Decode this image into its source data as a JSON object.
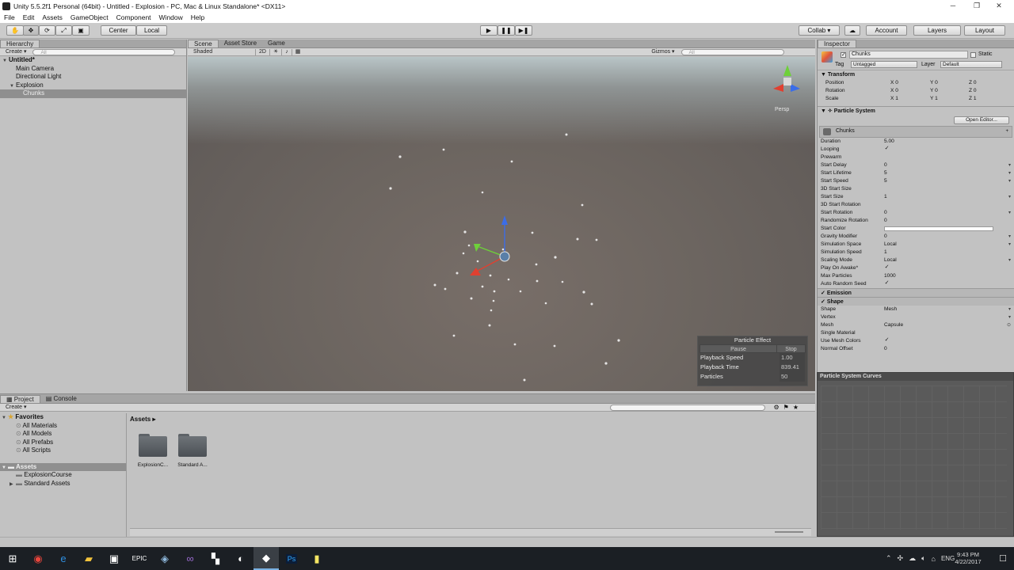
{
  "window": {
    "title": "Unity 5.5.2f1 Personal (64bit) - Untitled - Explosion - PC, Mac & Linux Standalone* <DX11>",
    "minimize": "─",
    "restore": "❐",
    "close": "✕"
  },
  "menu": [
    "File",
    "Edit",
    "Assets",
    "GameObject",
    "Component",
    "Window",
    "Help"
  ],
  "toolbar": {
    "pivot": "Center",
    "space": "Local",
    "collab": "Collab ▾",
    "account": "Account",
    "layers": "Layers",
    "layout": "Layout"
  },
  "hierarchy": {
    "tab": "Hierarchy",
    "create": "Create ▾",
    "search_placeholder": "All",
    "scene": "Untitled*",
    "items": [
      "Main Camera",
      "Directional Light",
      "Explosion",
      "Chunks"
    ]
  },
  "scene_view": {
    "tabs": [
      "Scene",
      "Asset Store",
      "Game"
    ],
    "shading": "Shaded",
    "mode_2d": "2D",
    "gizmos": "Gizmos ▾",
    "search_placeholder": "All",
    "persp": "Persp"
  },
  "particle_effect": {
    "title": "Particle Effect",
    "pause": "Pause",
    "stop": "Stop",
    "rows": [
      {
        "label": "Playback Speed",
        "value": "1.00"
      },
      {
        "label": "Playback Time",
        "value": "839.41"
      },
      {
        "label": "Particles",
        "value": "50"
      }
    ]
  },
  "inspector": {
    "tab": "Inspector",
    "object_name": "Chunks",
    "static": "Static",
    "tag_label": "Tag",
    "tag": "Untagged",
    "layer_label": "Layer",
    "layer": "Default",
    "transform": {
      "title": "Transform",
      "rows": [
        {
          "label": "Position",
          "x": "0",
          "y": "0",
          "z": "0"
        },
        {
          "label": "Rotation",
          "x": "0",
          "y": "0",
          "z": "0"
        },
        {
          "label": "Scale",
          "x": "1",
          "y": "1",
          "z": "1"
        }
      ]
    },
    "particle_system": {
      "title": "Particle System",
      "open_editor": "Open Editor...",
      "module_name": "Chunks",
      "props": [
        {
          "label": "Duration",
          "value": "5.00",
          "type": "text"
        },
        {
          "label": "Looping",
          "value": "✓",
          "type": "check"
        },
        {
          "label": "Prewarm",
          "value": "",
          "type": "check"
        },
        {
          "label": "Start Delay",
          "value": "0",
          "type": "drop"
        },
        {
          "label": "Start Lifetime",
          "value": "5",
          "type": "drop"
        },
        {
          "label": "Start Speed",
          "value": "5",
          "type": "drop"
        },
        {
          "label": "3D Start Size",
          "value": "",
          "type": "check"
        },
        {
          "label": "Start Size",
          "value": "1",
          "type": "drop"
        },
        {
          "label": "3D Start Rotation",
          "value": "",
          "type": "check"
        },
        {
          "label": "Start Rotation",
          "value": "0",
          "type": "drop"
        },
        {
          "label": "Randomize Rotation",
          "value": "0",
          "type": "text"
        },
        {
          "label": "Start Color",
          "value": "",
          "type": "color"
        },
        {
          "label": "Gravity Modifier",
          "value": "0",
          "type": "drop"
        },
        {
          "label": "Simulation Space",
          "value": "Local",
          "type": "drop"
        },
        {
          "label": "Simulation Speed",
          "value": "1",
          "type": "text"
        },
        {
          "label": "Scaling Mode",
          "value": "Local",
          "type": "drop"
        },
        {
          "label": "Play On Awake*",
          "value": "✓",
          "type": "check"
        },
        {
          "label": "Max Particles",
          "value": "1000",
          "type": "text"
        },
        {
          "label": "Auto Random Seed",
          "value": "✓",
          "type": "check"
        }
      ],
      "emission": "Emission",
      "shape": "Shape",
      "shape_props": [
        {
          "label": "Shape",
          "value": "Mesh",
          "type": "drop"
        },
        {
          "label": "Vertex",
          "value": "",
          "type": "drop"
        },
        {
          "label": "Mesh",
          "value": "Capsule",
          "type": "obj"
        },
        {
          "label": "Single Material",
          "value": "",
          "type": "check"
        },
        {
          "label": "Use Mesh Colors",
          "value": "✓",
          "type": "check"
        },
        {
          "label": "Normal Offset",
          "value": "0",
          "type": "text"
        }
      ]
    },
    "curves_title": "Particle System Curves"
  },
  "project": {
    "tabs": [
      "Project",
      "Console"
    ],
    "create": "Create ▾",
    "favorites_title": "Favorites",
    "favorites": [
      "All Materials",
      "All Models",
      "All Prefabs",
      "All Scripts"
    ],
    "assets_title": "Assets",
    "asset_folders": [
      "ExplosionCourse",
      "Standard Assets"
    ],
    "breadcrumb": "Assets ▸",
    "grid_items": [
      "ExplosionC...",
      "Standard A..."
    ]
  },
  "taskbar": {
    "lang": "ENG",
    "time": "9:43 PM",
    "date": "4/22/2017"
  }
}
